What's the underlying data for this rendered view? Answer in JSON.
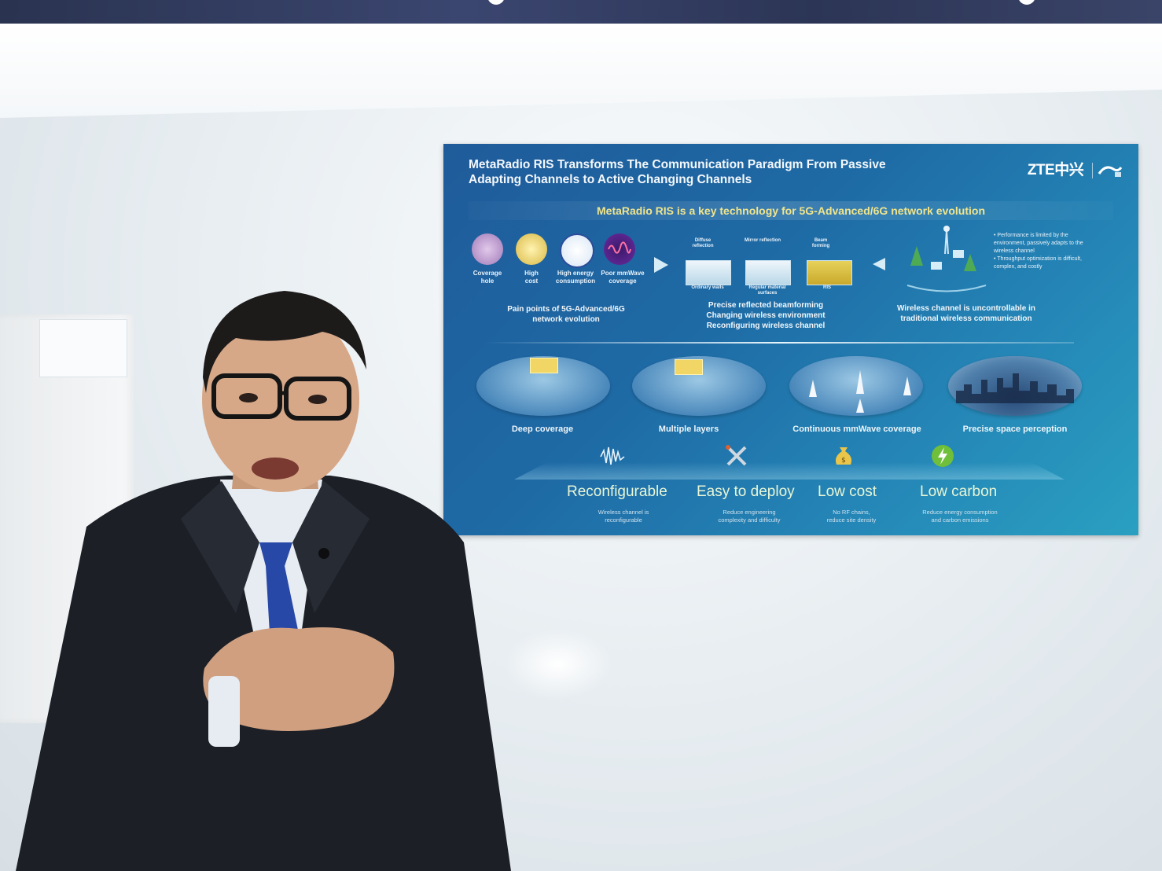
{
  "slide": {
    "title_line1": "MetaRadio RIS Transforms The Communication Paradigm From Passive",
    "title_line2": "Adapting Channels to Active Changing Channels",
    "brand": "ZTE中兴",
    "subtitle": "MetaRadio RIS is a key technology for 5G-Advanced/6G network evolution",
    "pain_points": [
      {
        "label_line1": "Coverage",
        "label_line2": "hole",
        "icon": "coverage-hole-icon",
        "color": "#c9a7d6"
      },
      {
        "label_line1": "High",
        "label_line2": "cost",
        "icon": "high-cost-icon",
        "color": "#f2dd7a"
      },
      {
        "label_line1": "High energy",
        "label_line2": "consumption",
        "icon": "high-energy-icon",
        "color": "#ffffff"
      },
      {
        "label_line1": "Poor mmWave",
        "label_line2": "coverage",
        "icon": "poor-mmwave-icon",
        "color": "#6a2aa0"
      }
    ],
    "pain_caption_line1": "Pain points of 5G-Advanced/6G",
    "pain_caption_line2": "network evolution",
    "surface_labels": [
      "Diffuse reflection",
      "Mirror reflection",
      "Beam forming"
    ],
    "surface_sub_labels": [
      "Ordinary walls",
      "Regular material surfaces",
      "RIS"
    ],
    "ris_caption_line1": "Precise reflected beamforming",
    "ris_caption_line2": "Changing wireless environment",
    "ris_caption_line3": "Reconfiguring wireless channel",
    "bullets": [
      "Performance is limited by the environment, passively adapts to the wireless channel",
      "Throughput optimization is difficult, complex, and costly"
    ],
    "uncontrollable_caption_line1": "Wireless channel is uncontrollable in",
    "uncontrollable_caption_line2": "traditional wireless communication",
    "scenarios": [
      "Deep coverage",
      "Multiple layers",
      "Continuous mmWave coverage",
      "Precise space perception"
    ],
    "features": [
      {
        "title": "Reconfigurable",
        "desc_line1": "Wireless channel is",
        "desc_line2": "reconfigurable",
        "icon": "waveform-icon"
      },
      {
        "title": "Easy to deploy",
        "desc_line1": "Reduce engineering",
        "desc_line2": "complexity and difficulty",
        "icon": "tools-icon"
      },
      {
        "title": "Low cost",
        "desc_line1": "No RF chains,",
        "desc_line2": "reduce site density",
        "icon": "money-bag-icon"
      },
      {
        "title": "Low carbon",
        "desc_line1": "Reduce energy consumption",
        "desc_line2": "and carbon emissions",
        "icon": "energy-bolt-icon"
      }
    ]
  },
  "colors": {
    "slide_bg": "#1e6aa5",
    "subtitle_text": "#f0e58c",
    "feature_text": "#e8f6d6",
    "wall": "#e9eef2",
    "suit": "#1c1f26",
    "tie": "#2848a8"
  }
}
